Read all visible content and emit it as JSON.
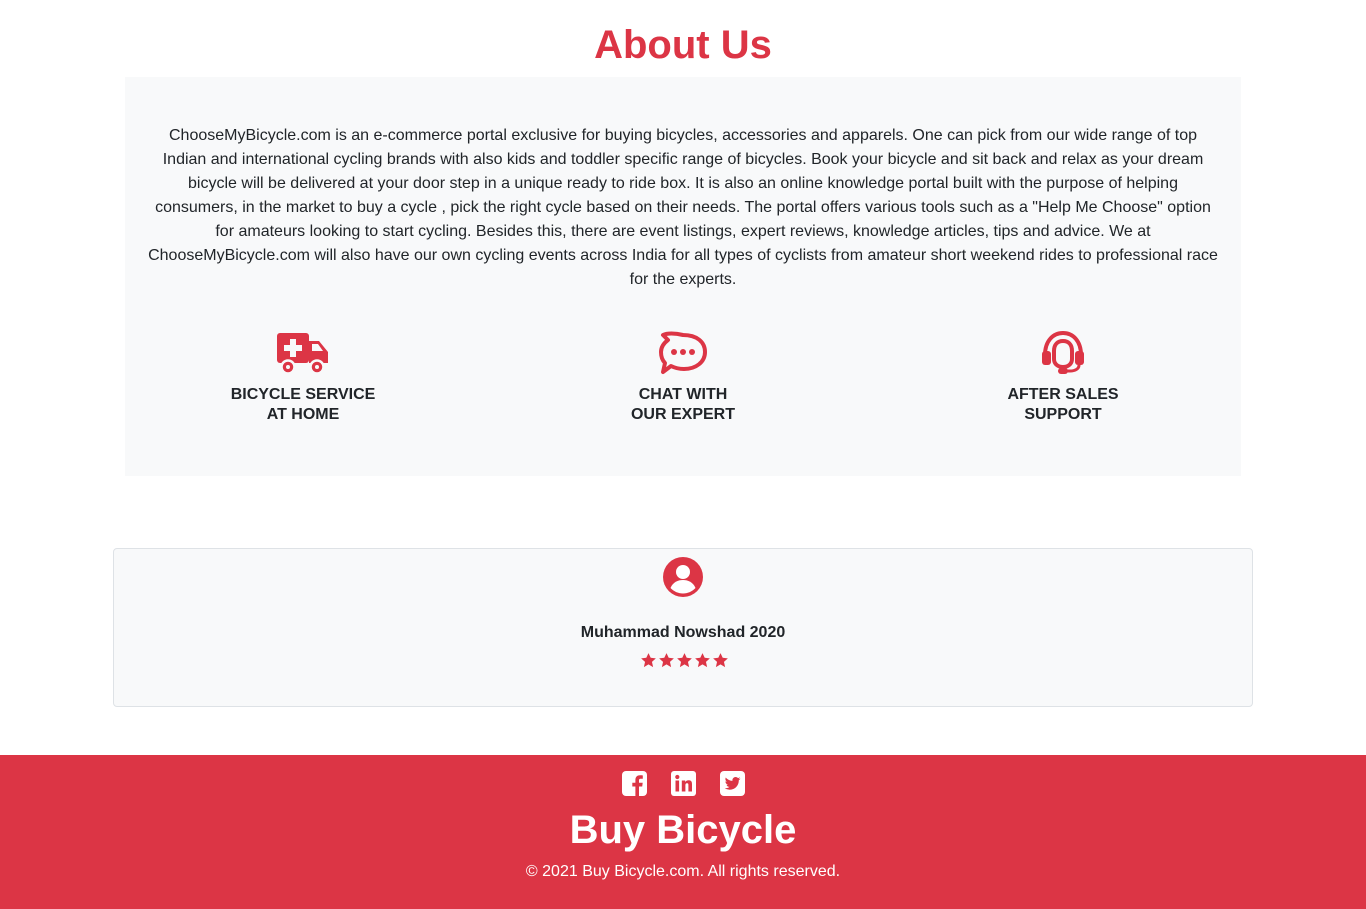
{
  "about": {
    "title": "About Us",
    "description": "ChooseMyBicycle.com is an e-commerce portal exclusive for buying bicycles, accessories and apparels. One can pick from our wide range of top Indian and international cycling brands with also kids and toddler specific range of bicycles. Book your bicycle and sit back and relax as your dream bicycle will be delivered at your door step in a unique ready to ride box. It is also an online knowledge portal built with the purpose of helping consumers, in the market to buy a cycle , pick the right cycle based on their needs. The portal offers various tools such as a \"Help Me Choose\" option for amateurs looking to start cycling. Besides this, there are event listings, expert reviews, knowledge articles, tips and advice. We at ChooseMyBicycle.com will also have our own cycling events across India for all types of cyclists from amateur short weekend rides to professional race for the experts.",
    "features": [
      {
        "icon": "ambulance-icon",
        "label": "BICYCLE SERVICE\nAT HOME"
      },
      {
        "icon": "chat-icon",
        "label": "CHAT WITH\nOUR EXPERT"
      },
      {
        "icon": "headset-icon",
        "label": "AFTER SALES\nSUPPORT"
      }
    ]
  },
  "review": {
    "avatar_icon": "user-circle-icon",
    "name": "Muhammad Nowshad 2020",
    "rating": 5,
    "rating_max": 5
  },
  "footer": {
    "social": [
      "facebook-icon",
      "linkedin-icon",
      "twitter-icon"
    ],
    "brand": "Buy Bicycle",
    "copyright": "© 2021 Buy Bicycle.com. All rights reserved."
  },
  "colors": {
    "accent": "#dc3545",
    "panel": "#f8f9fa",
    "text": "#212529"
  }
}
